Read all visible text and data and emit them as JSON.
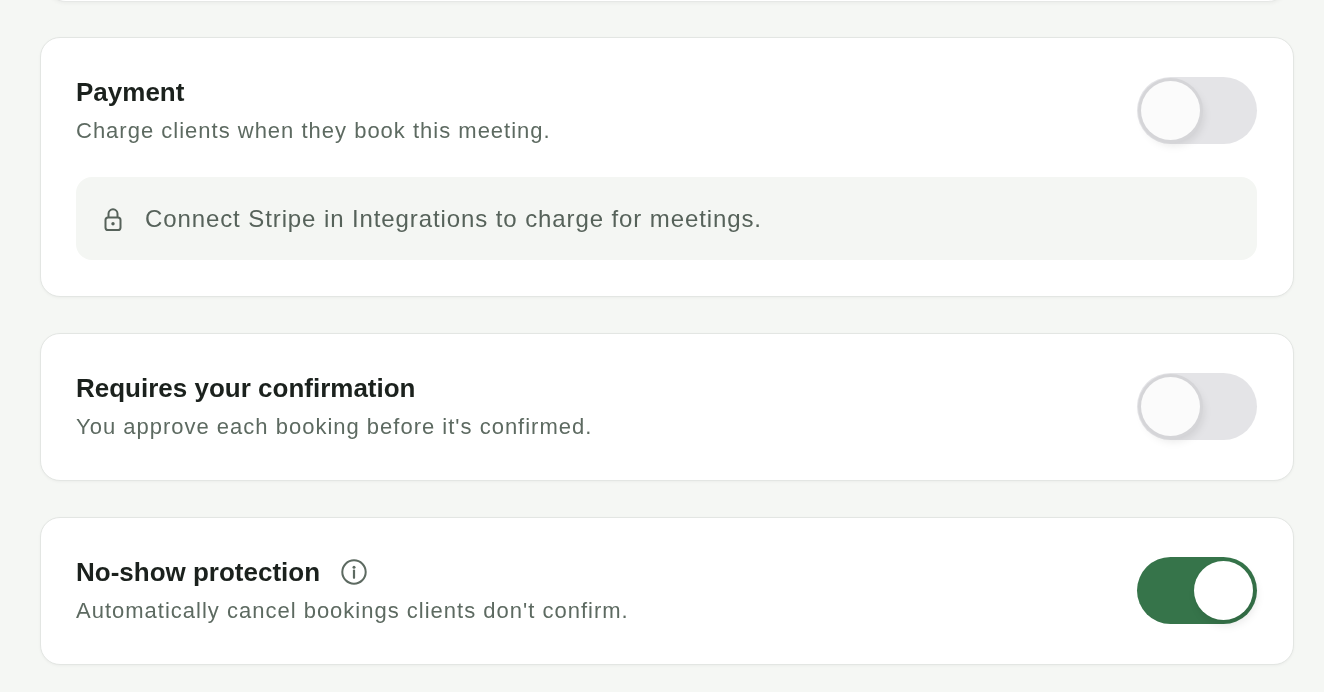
{
  "settings": [
    {
      "title": "Payment",
      "info_icon": false,
      "description": "Charge clients when they book this meeting.",
      "toggle": {
        "on": false
      },
      "notice": {
        "text": "Connect Stripe in Integrations to charge for meetings."
      }
    },
    {
      "title": "Requires your confirmation",
      "info_icon": false,
      "description": "You approve each booking before it's confirmed.",
      "toggle": {
        "on": false
      }
    },
    {
      "title": "No-show protection",
      "info_icon": true,
      "description": "Automatically cancel bookings clients don't confirm.",
      "toggle": {
        "on": true
      }
    }
  ]
}
